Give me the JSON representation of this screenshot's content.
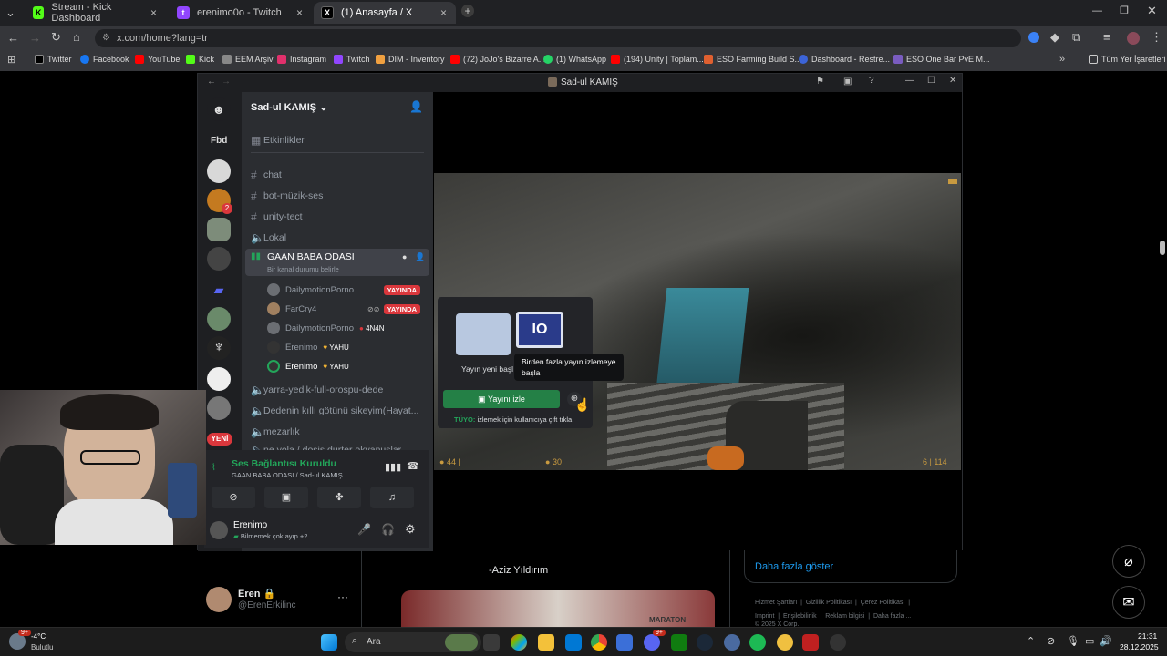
{
  "tabs": [
    {
      "title": "Stream - Kick Dashboard",
      "icon": "kick-icon",
      "color": "#53fc18",
      "active": false
    },
    {
      "title": "erenimo0o - Twitch",
      "icon": "twitch-icon",
      "color": "#9146ff",
      "active": false
    },
    {
      "title": "(1) Anasayfa / X",
      "icon": "x-icon",
      "color": "#ffffff",
      "active": true
    }
  ],
  "address": "x.com/home?lang=tr",
  "bookmarks": [
    {
      "label": "Twitter",
      "color": "#1d9bf0"
    },
    {
      "label": "Facebook",
      "color": "#1877f2"
    },
    {
      "label": "YouTube",
      "color": "#ff0000"
    },
    {
      "label": "Kick",
      "color": "#53fc18"
    },
    {
      "label": "EEM Arşiv",
      "color": "#888888"
    },
    {
      "label": "Instagram",
      "color": "#e1306c"
    },
    {
      "label": "Twitch",
      "color": "#9146ff"
    },
    {
      "label": "DIM - Inventory",
      "color": "#f0a040"
    },
    {
      "label": "(72) JoJo's Bizarre A...",
      "color": "#ff0000"
    },
    {
      "label": "(1) WhatsApp",
      "color": "#25d366"
    },
    {
      "label": "(194) Unity | Toplam...",
      "color": "#ff0000"
    },
    {
      "label": "ESO Farming Build S...",
      "color": "#e06030"
    },
    {
      "label": "Dashboard - Restre...",
      "color": "#3c64d8"
    },
    {
      "label": "ESO One Bar PvE M...",
      "color": "#7a5cc0"
    }
  ],
  "all_bookmarks": "Tüm Yer İşaretleri",
  "discord": {
    "window_title": "Sad-ul KAMIŞ",
    "server_name": "Sad-ul KAMIŞ",
    "rail_label": "Fbd",
    "badge_count": "2",
    "new_label": "YENİ",
    "events": "Etkinlikler",
    "channels": [
      {
        "name": "chat",
        "type": "text"
      },
      {
        "name": "bot-müzik-ses",
        "type": "text"
      },
      {
        "name": "unity-tect",
        "type": "text"
      },
      {
        "name": "Lokal",
        "type": "voice"
      }
    ],
    "active_voice": {
      "name": "GAAN BABA ODASI",
      "status": "Bir kanal durumu belirle"
    },
    "voice_users": [
      {
        "name": "DailymotionPorno",
        "tag": "YAYINDA",
        "tag_type": "live"
      },
      {
        "name": "FarCry4",
        "tag": "YAYINDA",
        "tag_type": "live"
      },
      {
        "name": "DailymotionPorno",
        "tag": "4N4N",
        "tag_type": "status"
      },
      {
        "name": "Erenimo",
        "tag": "YAHU",
        "tag_type": "status"
      },
      {
        "name": "Erenimo",
        "tag": "YAHU",
        "tag_type": "status"
      }
    ],
    "more_channels": [
      {
        "name": "yarra-yedik-full-orospu-dede"
      },
      {
        "name": "Dedenin kıllı götünü sikeyim(Hayat..."
      },
      {
        "name": "mezarlık"
      },
      {
        "name": "ne yola / dosis durter okyanuslar"
      }
    ],
    "voice_connected": "Ses Bağlantısı Kuruldu",
    "voice_sub": "GAAN BABA ODASI / Sad-ul KAMIŞ",
    "user_name": "Erenimo",
    "user_status": "Bilmemek çok ayıp +2",
    "popup": {
      "caption": "Yayın yeni başl",
      "watch_button": "Yayını izle",
      "tip_prefix": "TÜYO:",
      "tip_text": "izlemek için kullanıcıya çift tıkla",
      "tooltip": "Birden fazla yayın izlemeye başla"
    },
    "hud": {
      "left": "44",
      "mid": "30",
      "right": "6 | 114"
    }
  },
  "x_page": {
    "quote": "-Aziz Yıldırım",
    "show_more": "Daha fazla göster",
    "profile_name": "Eren",
    "profile_handle": "@ErenErkilinc",
    "footer_links": [
      "Hizmet Şartları",
      "Gizlilik Politikası",
      "Çerez Politikası",
      "Imprint",
      "Erişilebilirlik",
      "Reklam bilgisi",
      "Daha fazla ..."
    ],
    "footer_copy": "© 2025 X Corp."
  },
  "taskbar": {
    "weather_temp": "-4°C",
    "weather_desc": "Bulutlu",
    "weather_badge": "9+",
    "search": "Ara",
    "time": "21:31",
    "date": "28.12.2025",
    "discord_badge": "9+"
  }
}
